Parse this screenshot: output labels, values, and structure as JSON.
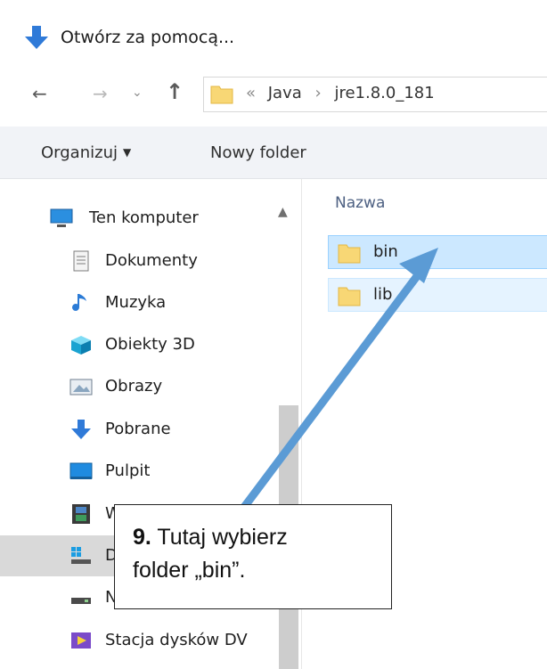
{
  "window": {
    "title": "Otwórz za pomocą...",
    "title_icon": "download-arrow-icon"
  },
  "address_bar": {
    "overflow_marker": "«",
    "crumbs": [
      "Java",
      "jre1.8.0_181"
    ],
    "separator": "›",
    "back_icon": "back-arrow-icon",
    "forward_icon": "forward-arrow-icon",
    "recent_icon": "chevron-down-icon",
    "up_icon": "up-arrow-icon"
  },
  "toolbar": {
    "organize_label": "Organizuj",
    "new_folder_label": "Nowy folder"
  },
  "nav_pane": {
    "items": [
      {
        "label": "Ten komputer",
        "icon": "computer-icon"
      },
      {
        "label": "Dokumenty",
        "icon": "document-icon"
      },
      {
        "label": "Muzyka",
        "icon": "music-icon"
      },
      {
        "label": "Obiekty 3D",
        "icon": "cube-3d-icon"
      },
      {
        "label": "Obrazy",
        "icon": "pictures-icon"
      },
      {
        "label": "Pobrane",
        "icon": "download-arrow-icon"
      },
      {
        "label": "Pulpit",
        "icon": "desktop-icon"
      },
      {
        "label": "W",
        "icon": "video-icon"
      },
      {
        "label": "D",
        "icon": "windows-drive-icon",
        "selected": true
      },
      {
        "label": "N",
        "icon": "drive-icon"
      },
      {
        "label": "Stacja dysków DV",
        "icon": "dvd-drive-icon"
      }
    ]
  },
  "content": {
    "column_header": "Nazwa",
    "files": [
      {
        "name": "bin",
        "icon": "folder-icon",
        "state": "selected"
      },
      {
        "name": "lib",
        "icon": "folder-icon",
        "state": "hover"
      }
    ]
  },
  "callout": {
    "step": "9.",
    "text_line1": "Tutaj wybierz",
    "text_line2": "folder „bin”."
  },
  "colors": {
    "arrow": "#5b9bd5",
    "selection": "#cce8ff",
    "toolbar_bg": "#f1f3f7",
    "folder": "#f8d775",
    "header_text": "#4d6082"
  }
}
